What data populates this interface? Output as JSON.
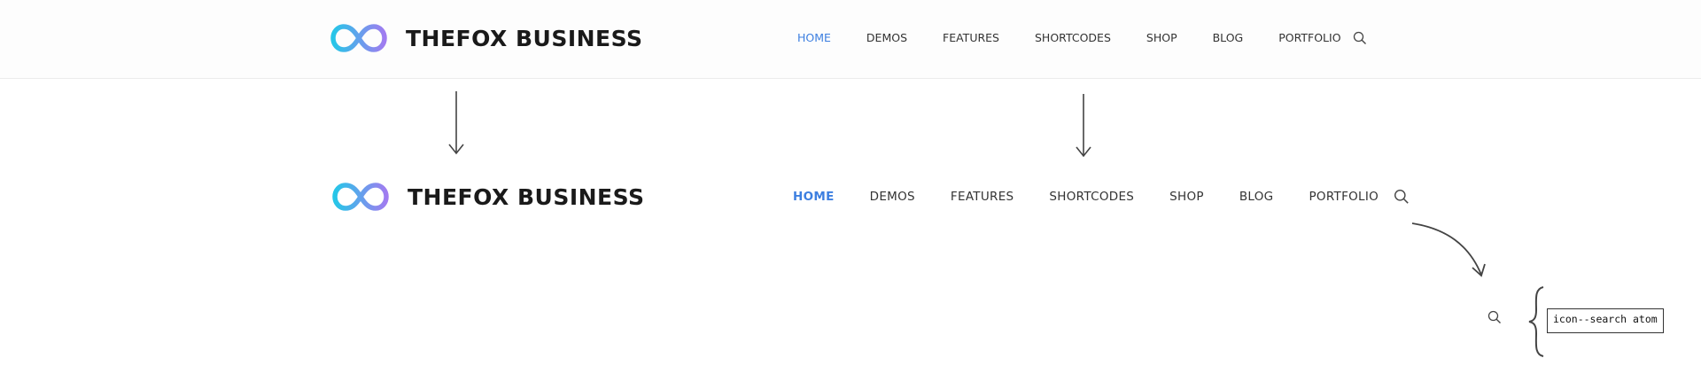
{
  "header": {
    "brand": "THEFOX BUSINESS",
    "nav_items": [
      "HOME",
      "DEMOS",
      "FEATURES",
      "SHORTCODES",
      "SHOP",
      "BLOG",
      "PORTFOLIO"
    ],
    "active_item": "HOME",
    "search_icon": "search-icon"
  },
  "molecule": {
    "brand": "THEFOX BUSINESS",
    "nav_items": [
      "HOME",
      "DEMOS",
      "FEATURES",
      "SHORTCODES",
      "SHOP",
      "BLOG",
      "PORTFOLIO"
    ],
    "active_item": "HOME",
    "search_icon": "search-icon"
  },
  "atom": {
    "icon": "search-icon",
    "callout_label": "icon--search atom"
  },
  "colors": {
    "accent": "#3d7fe0",
    "logo_gradient_start": "#26c6e8",
    "logo_gradient_end": "#a07cf0",
    "text": "#333333"
  }
}
